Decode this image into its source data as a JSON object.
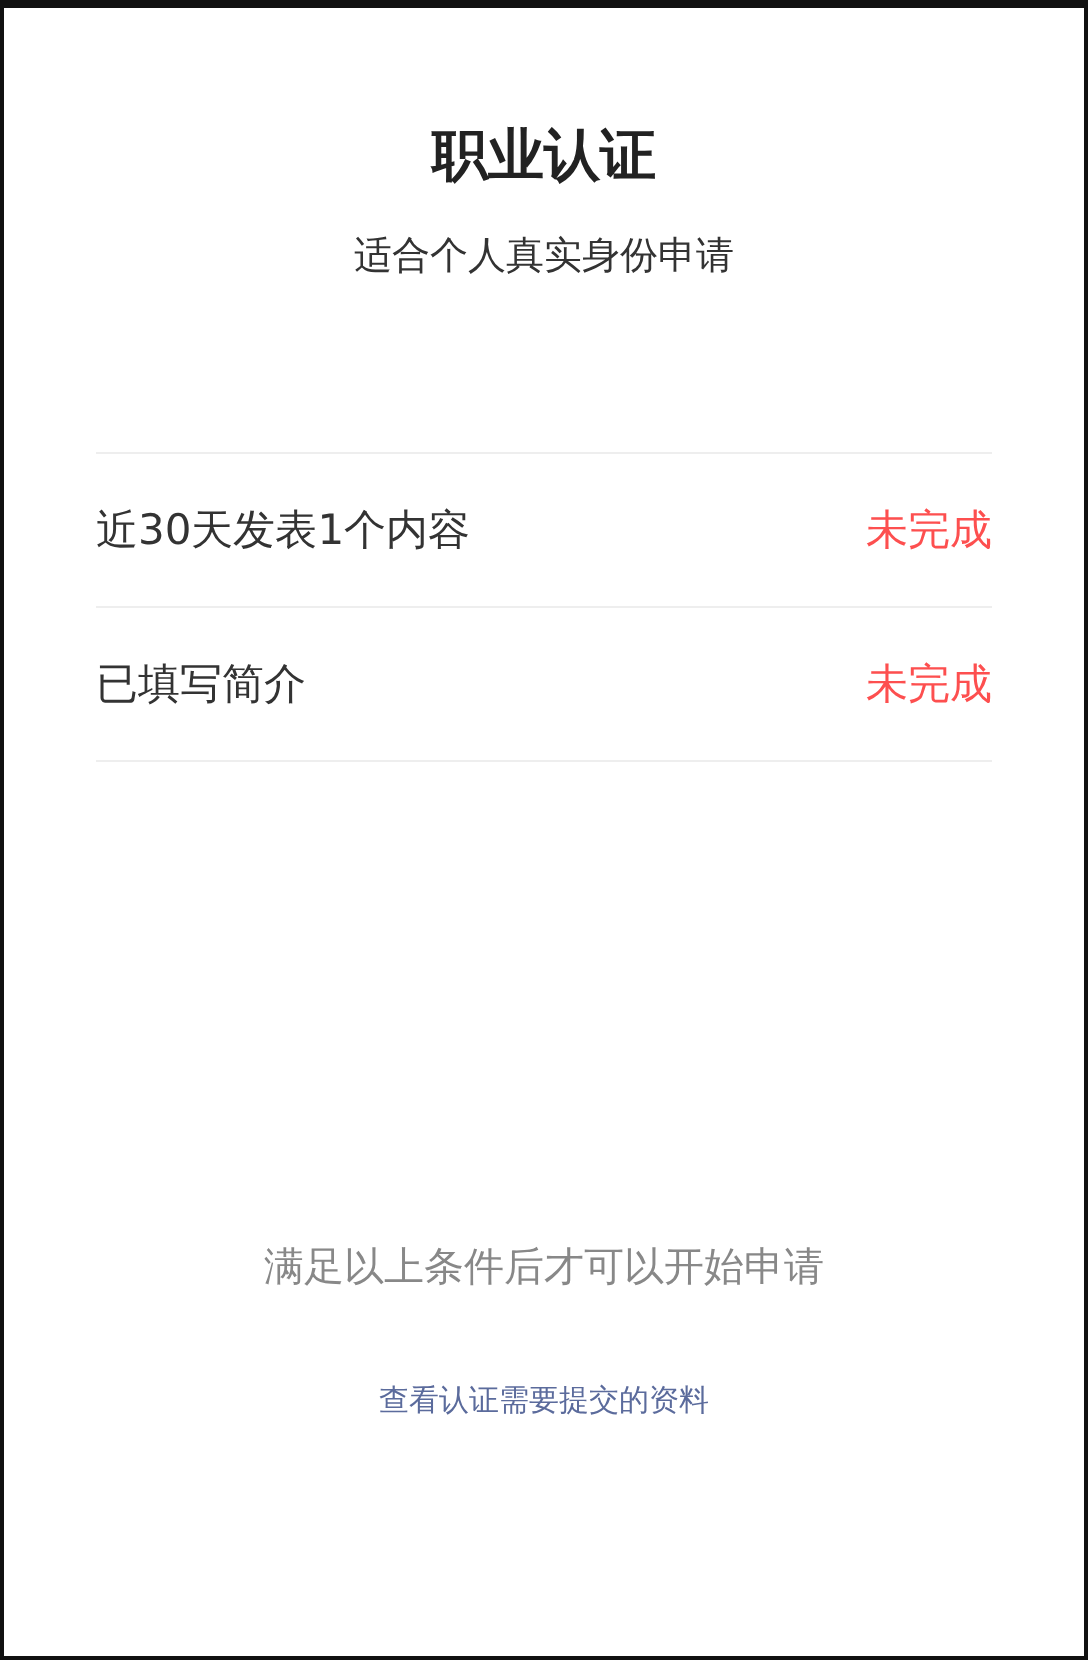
{
  "header": {
    "title": "职业认证",
    "subtitle": "适合个人真实身份申请"
  },
  "requirements": [
    {
      "label": "近30天发表1个内容",
      "status": "未完成",
      "done": false
    },
    {
      "label": "已填写简介",
      "status": "未完成",
      "done": false
    }
  ],
  "notice": "满足以上条件后才可以开始申请",
  "link": "查看认证需要提交的资料"
}
